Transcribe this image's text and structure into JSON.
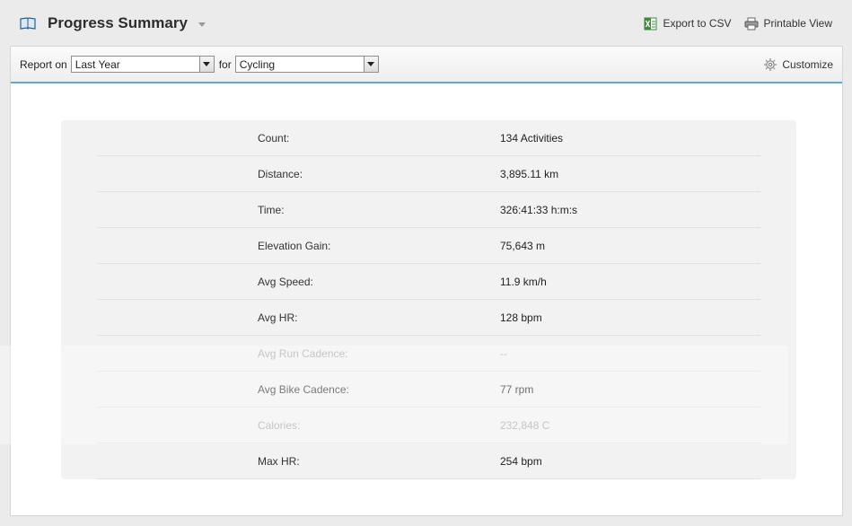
{
  "header": {
    "title": "Progress Summary",
    "export_csv": "Export to CSV",
    "printable_view": "Printable View"
  },
  "toolbar": {
    "report_on_label": "Report on",
    "period_value": "Last Year",
    "for_label": "for",
    "activity_value": "Cycling",
    "customize_label": "Customize"
  },
  "summary": {
    "rows": [
      {
        "label": "Count:",
        "value": "134 Activities",
        "muted": false
      },
      {
        "label": "Distance:",
        "value": "3,895.11 km",
        "muted": false
      },
      {
        "label": "Time:",
        "value": "326:41:33 h:m:s",
        "muted": false
      },
      {
        "label": "Elevation Gain:",
        "value": "75,643 m",
        "muted": false
      },
      {
        "label": "Avg Speed:",
        "value": "11.9 km/h",
        "muted": false
      },
      {
        "label": "Avg HR:",
        "value": "128 bpm",
        "muted": false
      },
      {
        "label": "Avg Run Cadence:",
        "value": "--",
        "muted": true
      },
      {
        "label": "Avg Bike Cadence:",
        "value": "77 rpm",
        "muted": false
      },
      {
        "label": "Calories:",
        "value": "232,848 C",
        "muted": true
      },
      {
        "label": "Max HR:",
        "value": "254 bpm",
        "muted": false
      }
    ]
  },
  "colors": {
    "accent": "#5aa8dc",
    "panel_bg": "#f2f2f2",
    "muted_text": "#a6a6a6",
    "csv_icon": "#3a8a3a"
  },
  "icons": {
    "title": "book-icon",
    "export": "excel-icon",
    "print": "printer-icon",
    "customize": "gear-icon"
  }
}
